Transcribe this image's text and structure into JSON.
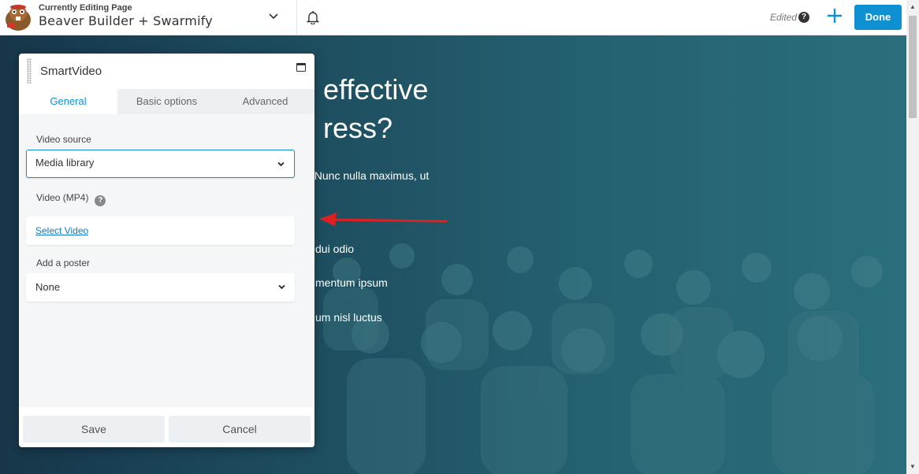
{
  "topbar": {
    "editing_label": "Currently Editing Page",
    "page_name": "Beaver Builder + Swarmify",
    "edited_label": "Edited",
    "help_glyph": "?",
    "done_label": "Done"
  },
  "hero": {
    "heading_line1": "effective",
    "heading_line2": "ress?",
    "paragraph": "it. Nunc nulla maximus, ut",
    "list": [
      "dui odio",
      "mentum ipsum",
      "um nisl luctus"
    ]
  },
  "panel": {
    "title": "SmartVideo",
    "tabs": [
      {
        "label": "General",
        "active": true
      },
      {
        "label": "Basic options",
        "active": false
      },
      {
        "label": "Advanced",
        "active": false
      }
    ],
    "video_source": {
      "label": "Video source",
      "value": "Media library"
    },
    "video_mp4": {
      "label": "Video (MP4)",
      "help": "?",
      "link": "Select Video"
    },
    "poster": {
      "label": "Add a poster",
      "value": "None"
    },
    "save_label": "Save",
    "cancel_label": "Cancel"
  },
  "colors": {
    "accent": "#0e90d2",
    "arrow": "#e02020",
    "hero_bg": "#1e4a5c"
  },
  "icons": [
    "beaver-logo-icon",
    "chevron-down-icon",
    "bell-icon",
    "help-icon",
    "plus-icon",
    "grip-icon",
    "maximize-icon"
  ]
}
